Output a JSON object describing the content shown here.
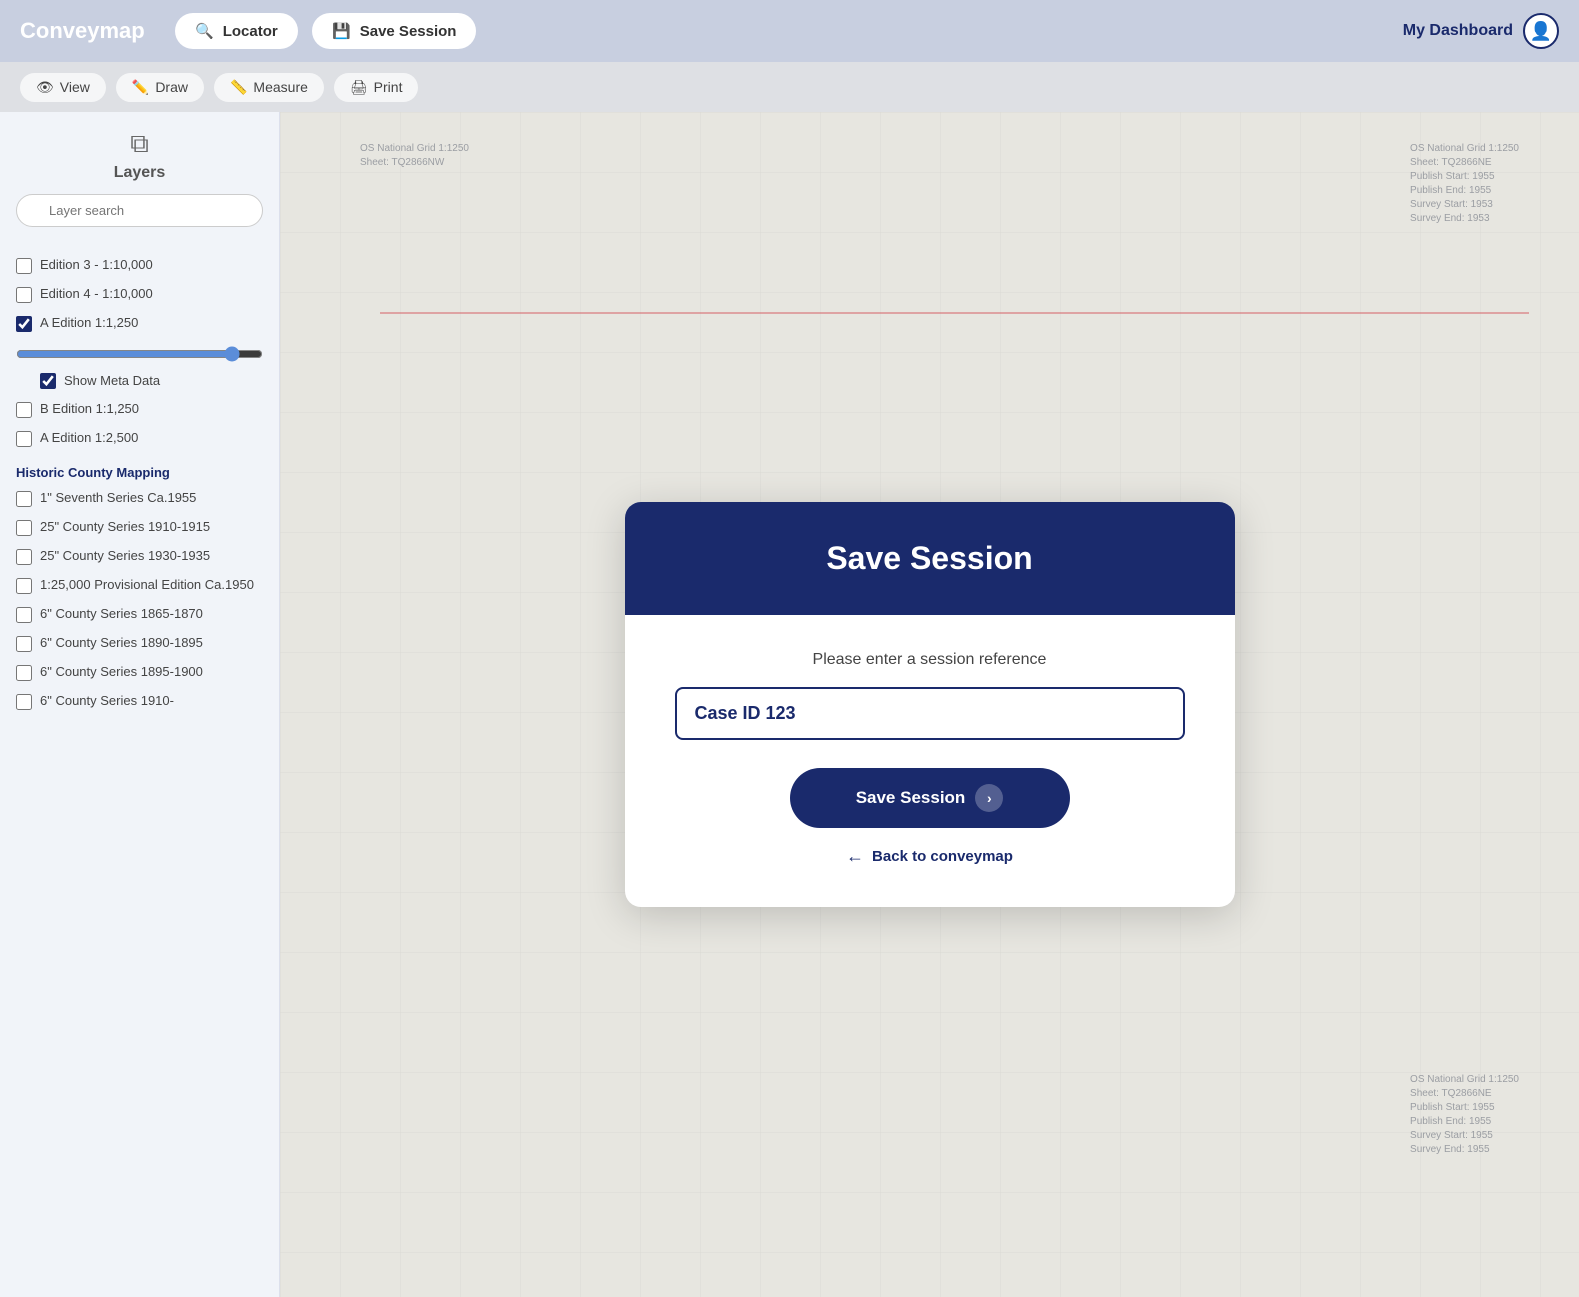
{
  "app": {
    "logo": "Conveymap",
    "dashboard_label": "My Dashboard"
  },
  "topbar": {
    "locator_label": "Locator",
    "save_session_label": "Save Session"
  },
  "toolbar": {
    "view_label": "View",
    "draw_label": "Draw",
    "measure_label": "Measure",
    "print_label": "Print"
  },
  "sidebar": {
    "layers_title": "Layers",
    "search_placeholder": "Layer search",
    "layers": [
      {
        "label": "Edition 3 - 1:10,000",
        "checked": false
      },
      {
        "label": "Edition 4 - 1:10,000",
        "checked": false
      },
      {
        "label": "A Edition 1:1,250",
        "checked": true
      }
    ],
    "show_meta_data_label": "Show Meta Data",
    "show_meta_checked": true,
    "b_edition_label": "B Edition 1:1,250",
    "b_edition_checked": false,
    "a_edition_2500_label": "A Edition 1:2,500",
    "a_edition_2500_checked": false,
    "historic_section": "Historic County Mapping",
    "historic_layers": [
      {
        "label": "1\" Seventh Series Ca.1955",
        "checked": false
      },
      {
        "label": "25\" County Series 1910-1915",
        "checked": false
      },
      {
        "label": "25\" County Series 1930-1935",
        "checked": false
      },
      {
        "label": "1:25,000 Provisional Edition Ca.1950",
        "checked": false
      },
      {
        "label": "6\" County Series 1865-1870",
        "checked": false
      },
      {
        "label": "6\" County Series 1890-1895",
        "checked": false
      },
      {
        "label": "6\" County Series 1895-1900",
        "checked": false
      },
      {
        "label": "6\" County Series 1910-",
        "checked": false
      }
    ]
  },
  "map": {
    "label_top_left": "OS National Grid 1:1250\nSheet: TQ2866NW",
    "label_top_right": "OS National Grid 1:1250\nSheet: TQ2866NE\nPublish Start: 1955\nPublish End: 1955\nSurvey Start: 1953\nSurvey End: 1953",
    "label_bottom_right": "OS National Grid 1:1250\nSheet: TQ2866NE\nPublish Start: 1955\nPublish End: 1955\nSurvey Start: 1955\nSurvey End: 1955"
  },
  "modal": {
    "title": "Save Session",
    "subtitle": "Please enter a session reference",
    "input_value": "Case ID 123",
    "save_button_label": "Save Session",
    "back_link_label": "Back to conveymap"
  }
}
